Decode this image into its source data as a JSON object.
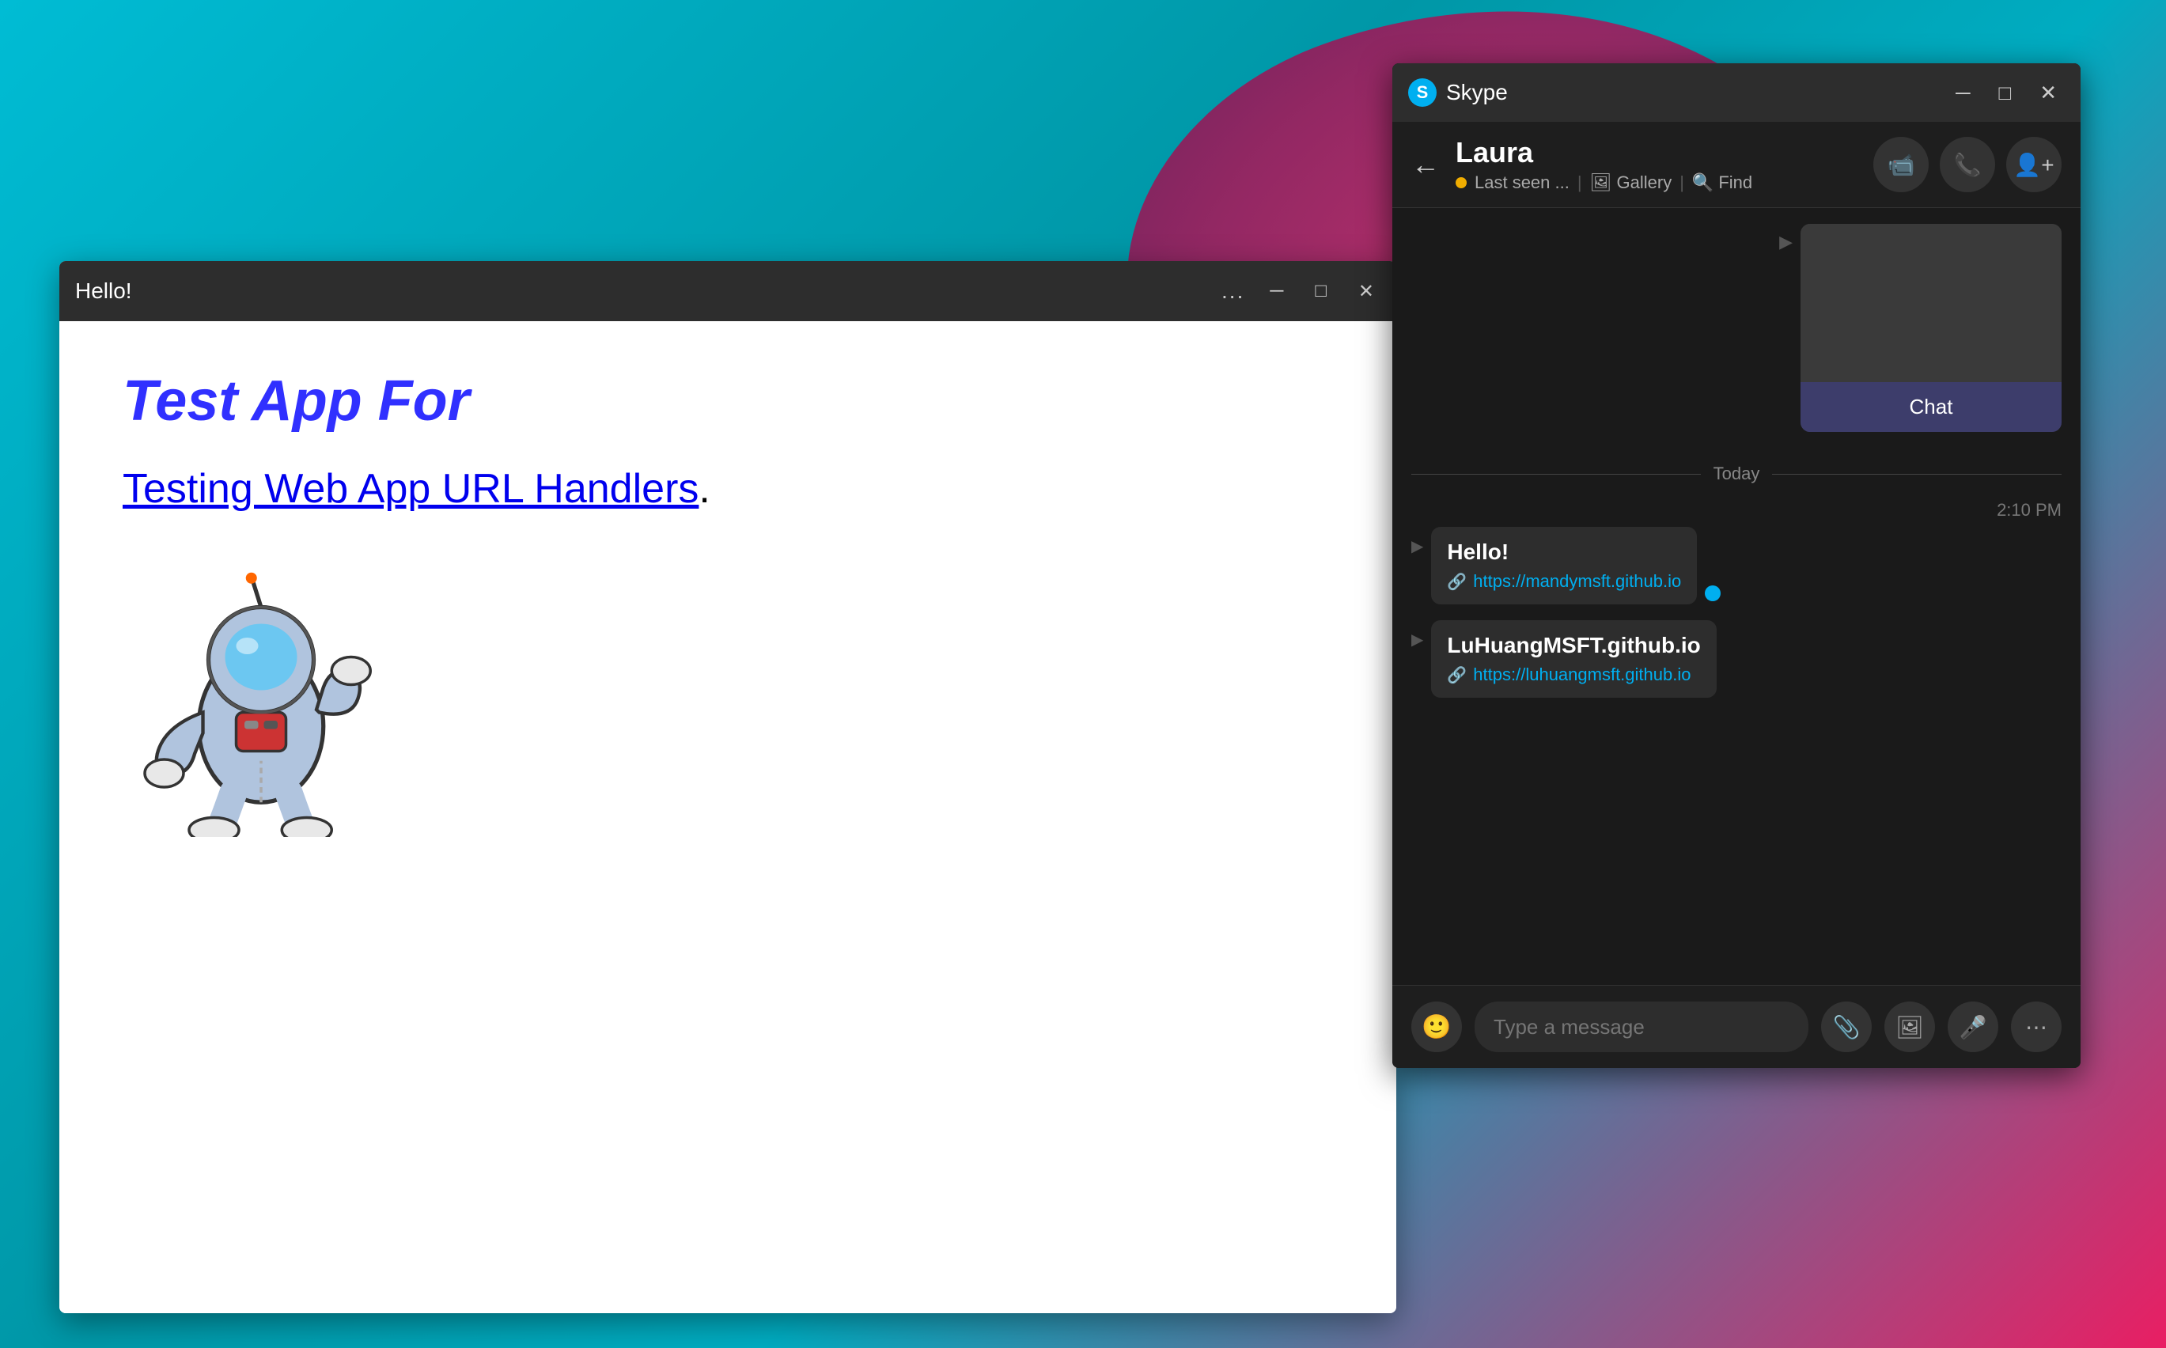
{
  "desktop": {
    "bg_color": "#00bcd4"
  },
  "hello_window": {
    "title": "Hello!",
    "heading": "Test App For",
    "link_text": "Testing Web App URL Handlers",
    "link_period": ".",
    "controls": {
      "dots": "...",
      "minimize": "─",
      "maximize": "□",
      "close": "✕"
    }
  },
  "skype_window": {
    "title": "Skype",
    "header": {
      "contact_name": "Laura",
      "status_text": "Last seen ...",
      "gallery_label": "Gallery",
      "find_label": "Find"
    },
    "chat": {
      "media_card_label": "Chat",
      "today_label": "Today",
      "timestamp": "2:10 PM",
      "messages": [
        {
          "title": "Hello!",
          "link": "https://mandymsft.github.io"
        },
        {
          "title": "LuHuangMSFT.github.io",
          "link": "https://luhuangmsft.github.io"
        }
      ]
    },
    "input": {
      "placeholder": "Type a message"
    },
    "controls": {
      "minimize": "─",
      "maximize": "□",
      "close": "✕"
    }
  }
}
